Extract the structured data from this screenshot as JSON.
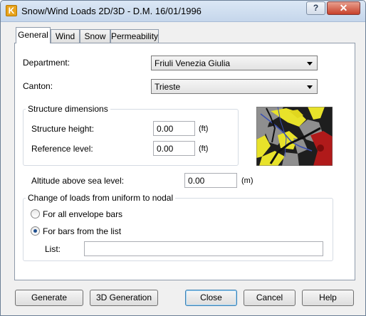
{
  "window": {
    "title": "Snow/Wind Loads 2D/3D - D.M. 16/01/1996",
    "help_glyph": "?",
    "close_glyph": "✕",
    "app_icon_letter": "K"
  },
  "tabs": [
    {
      "label": "General",
      "active": true
    },
    {
      "label": "Wind",
      "active": false
    },
    {
      "label": "Snow",
      "active": false
    },
    {
      "label": "Permeability",
      "active": false
    }
  ],
  "general": {
    "department_label": "Department:",
    "department_value": "Friuli Venezia Giulia",
    "canton_label": "Canton:",
    "canton_value": "Trieste",
    "structure_dimensions": {
      "title": "Structure dimensions",
      "height_label": "Structure height:",
      "height_value": "0.00",
      "height_unit": "(ft)",
      "reference_label": "Reference level:",
      "reference_value": "0.00",
      "reference_unit": "(ft)"
    },
    "altitude_label": "Altitude above sea level:",
    "altitude_value": "0.00",
    "altitude_unit": "(m)",
    "load_change": {
      "title": "Change of loads from uniform to nodal",
      "option_all": "For all envelope bars",
      "option_list": "For bars from the list",
      "selected": "list",
      "list_label": "List:",
      "list_value": ""
    },
    "map_icon": "region-map-icon"
  },
  "buttons": {
    "generate": "Generate",
    "generation_3d": "3D Generation",
    "close": "Close",
    "cancel": "Cancel",
    "help": "Help"
  }
}
